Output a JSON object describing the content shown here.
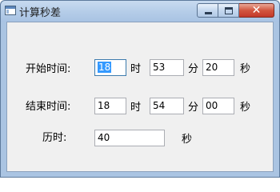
{
  "window": {
    "title": "计算秒差",
    "app_icon": "window-app-icon"
  },
  "caption_buttons": {
    "minimize": "minimize-icon",
    "maximize": "maximize-icon",
    "close_glyph": "✕"
  },
  "start": {
    "label": "开始时间:",
    "hour": "18",
    "hour_unit": "时",
    "minute": "53",
    "minute_unit": "分",
    "second": "20",
    "second_unit": "秒"
  },
  "end": {
    "label": "结束时间:",
    "hour": "18",
    "hour_unit": "时",
    "minute": "54",
    "minute_unit": "分",
    "second": "00",
    "second_unit": "秒"
  },
  "duration": {
    "label": "历时:",
    "value": "40",
    "unit": "秒"
  }
}
